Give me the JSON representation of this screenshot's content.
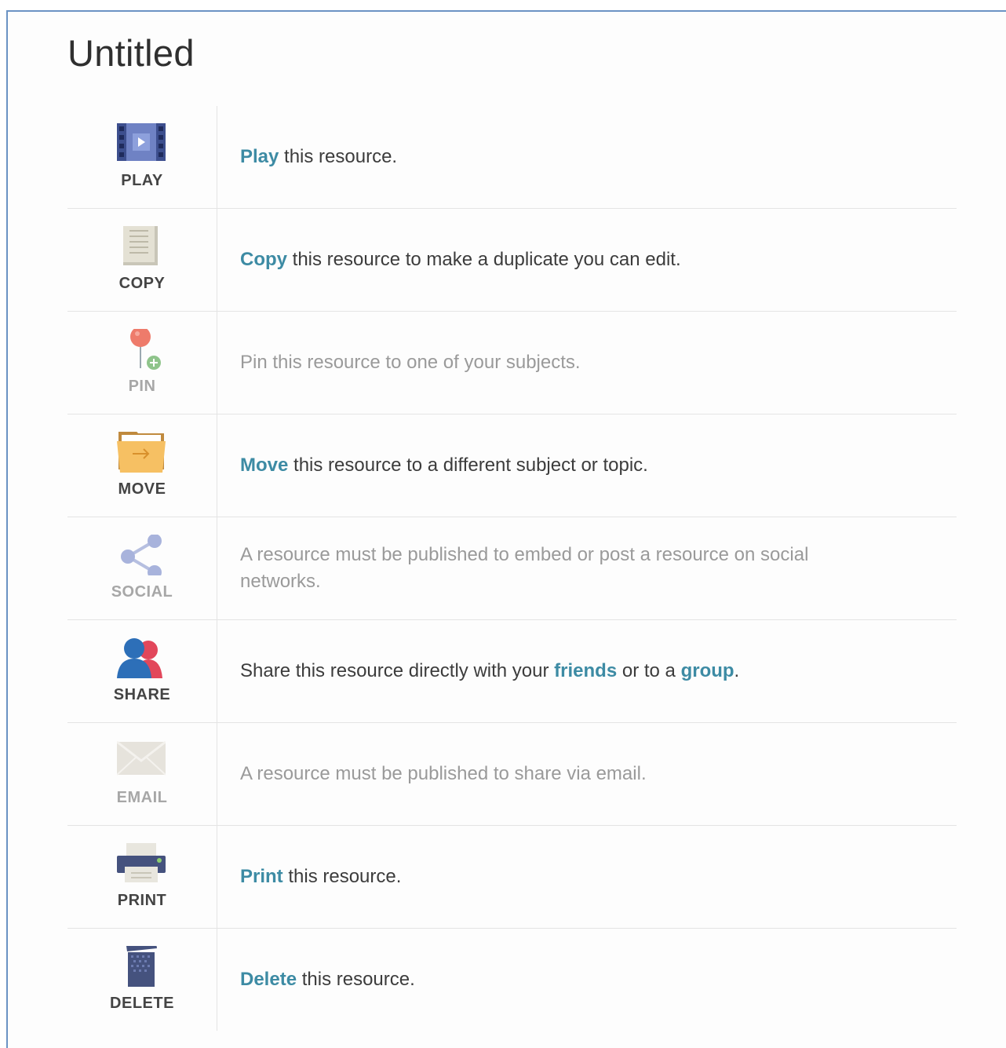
{
  "page": {
    "title": "Untitled"
  },
  "colors": {
    "link": "#3d8ba4",
    "text": "#3c3c3c",
    "disabled": "#9a9a9a"
  },
  "rows": {
    "play": {
      "icon": "film-play-icon",
      "label": "PLAY",
      "action": "Play",
      "rest": " this resource."
    },
    "copy": {
      "icon": "document-icon",
      "label": "COPY",
      "action": "Copy",
      "rest": " this resource to make a duplicate you can edit."
    },
    "pin": {
      "icon": "pushpin-icon",
      "label": "PIN",
      "text": "Pin this resource to one of your subjects."
    },
    "move": {
      "icon": "folder-arrow-icon",
      "label": "MOVE",
      "action": "Move",
      "rest": " this resource to a different subject or topic."
    },
    "social": {
      "icon": "share-network-icon",
      "label": "SOCIAL",
      "text": "A resource must be published to embed or post a resource on social networks."
    },
    "share": {
      "icon": "people-icon",
      "label": "SHARE",
      "pre": "Share this resource directly with your ",
      "link1": "friends",
      "mid": " or to a ",
      "link2": "group",
      "post": "."
    },
    "email": {
      "icon": "envelope-icon",
      "label": "EMAIL",
      "text": "A resource must be published to share via email."
    },
    "print": {
      "icon": "printer-icon",
      "label": "PRINT",
      "action": "Print",
      "rest": " this resource."
    },
    "delete": {
      "icon": "trash-can-icon",
      "label": "DELETE",
      "action": "Delete",
      "rest": " this resource."
    }
  }
}
